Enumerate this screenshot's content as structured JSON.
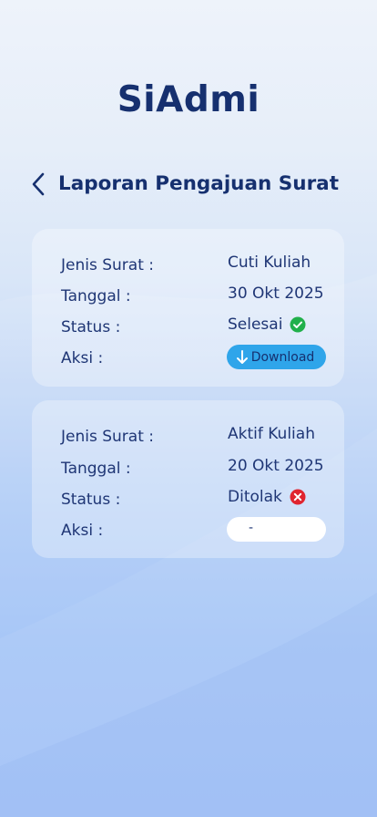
{
  "app": {
    "title": "SiAdmi"
  },
  "header": {
    "page_title": "Laporan Pengajuan Surat"
  },
  "labels": {
    "jenis_surat": "Jenis Surat :",
    "tanggal": "Tanggal :",
    "status": "Status :",
    "aksi": "Aksi :"
  },
  "letters": [
    {
      "jenis_surat": "Cuti Kuliah",
      "tanggal": "30 Okt 2025",
      "status": "Selesai",
      "status_icon": "check-circle-icon",
      "status_color": "#21b04b",
      "action_label": "Download",
      "action_color": "#2fa5ea"
    },
    {
      "jenis_surat": "Aktif Kuliah",
      "tanggal": "20 Okt 2025",
      "status": "Ditolak",
      "status_icon": "x-circle-icon",
      "status_color": "#e0242f",
      "action_label": "-",
      "action_color": "#ffffff"
    }
  ],
  "colors": {
    "primary_text": "#16306f",
    "background_top": "#eef3fa",
    "background_bottom": "#98bcf6"
  }
}
